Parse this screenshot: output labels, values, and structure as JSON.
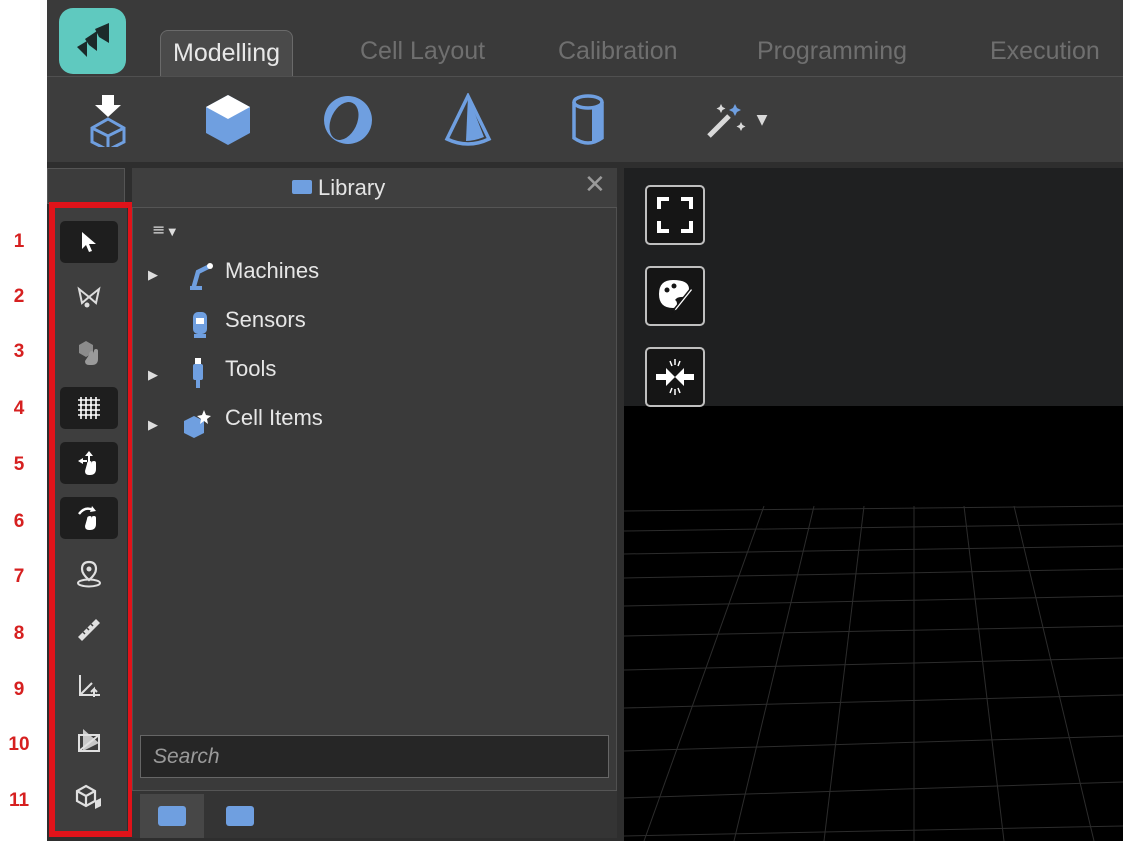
{
  "annotations": [
    "1",
    "2",
    "3",
    "4",
    "5",
    "6",
    "7",
    "8",
    "9",
    "10",
    "11"
  ],
  "tabs": [
    "Modelling",
    "Cell Layout",
    "Calibration",
    "Programming",
    "Execution"
  ],
  "toolbar": {
    "buttons": [
      "import-icon",
      "box-icon",
      "sphere-icon",
      "cone-icon",
      "cylinder-icon",
      "magic-wand-icon"
    ]
  },
  "sidebar": {
    "tools": [
      "select-icon",
      "lasso-icon",
      "hand-object-icon",
      "grid-icon",
      "move-icon",
      "rotate-icon",
      "location-icon",
      "ruler-icon",
      "axes-icon",
      "section-icon",
      "cube-view-icon"
    ]
  },
  "library": {
    "title": "Library",
    "items": [
      {
        "label": "Machines",
        "expandable": true,
        "icon": "robot-arm-icon"
      },
      {
        "label": "Sensors",
        "expandable": false,
        "icon": "sensor-icon"
      },
      {
        "label": "Tools",
        "expandable": true,
        "icon": "tool-icon"
      },
      {
        "label": "Cell Items",
        "expandable": true,
        "icon": "cell-items-icon"
      }
    ],
    "search_placeholder": "Search"
  },
  "colors": {
    "accent_blue": "#6f9fe0",
    "annotation_red": "#e0131a",
    "logo_teal": "#5fc9bf"
  }
}
